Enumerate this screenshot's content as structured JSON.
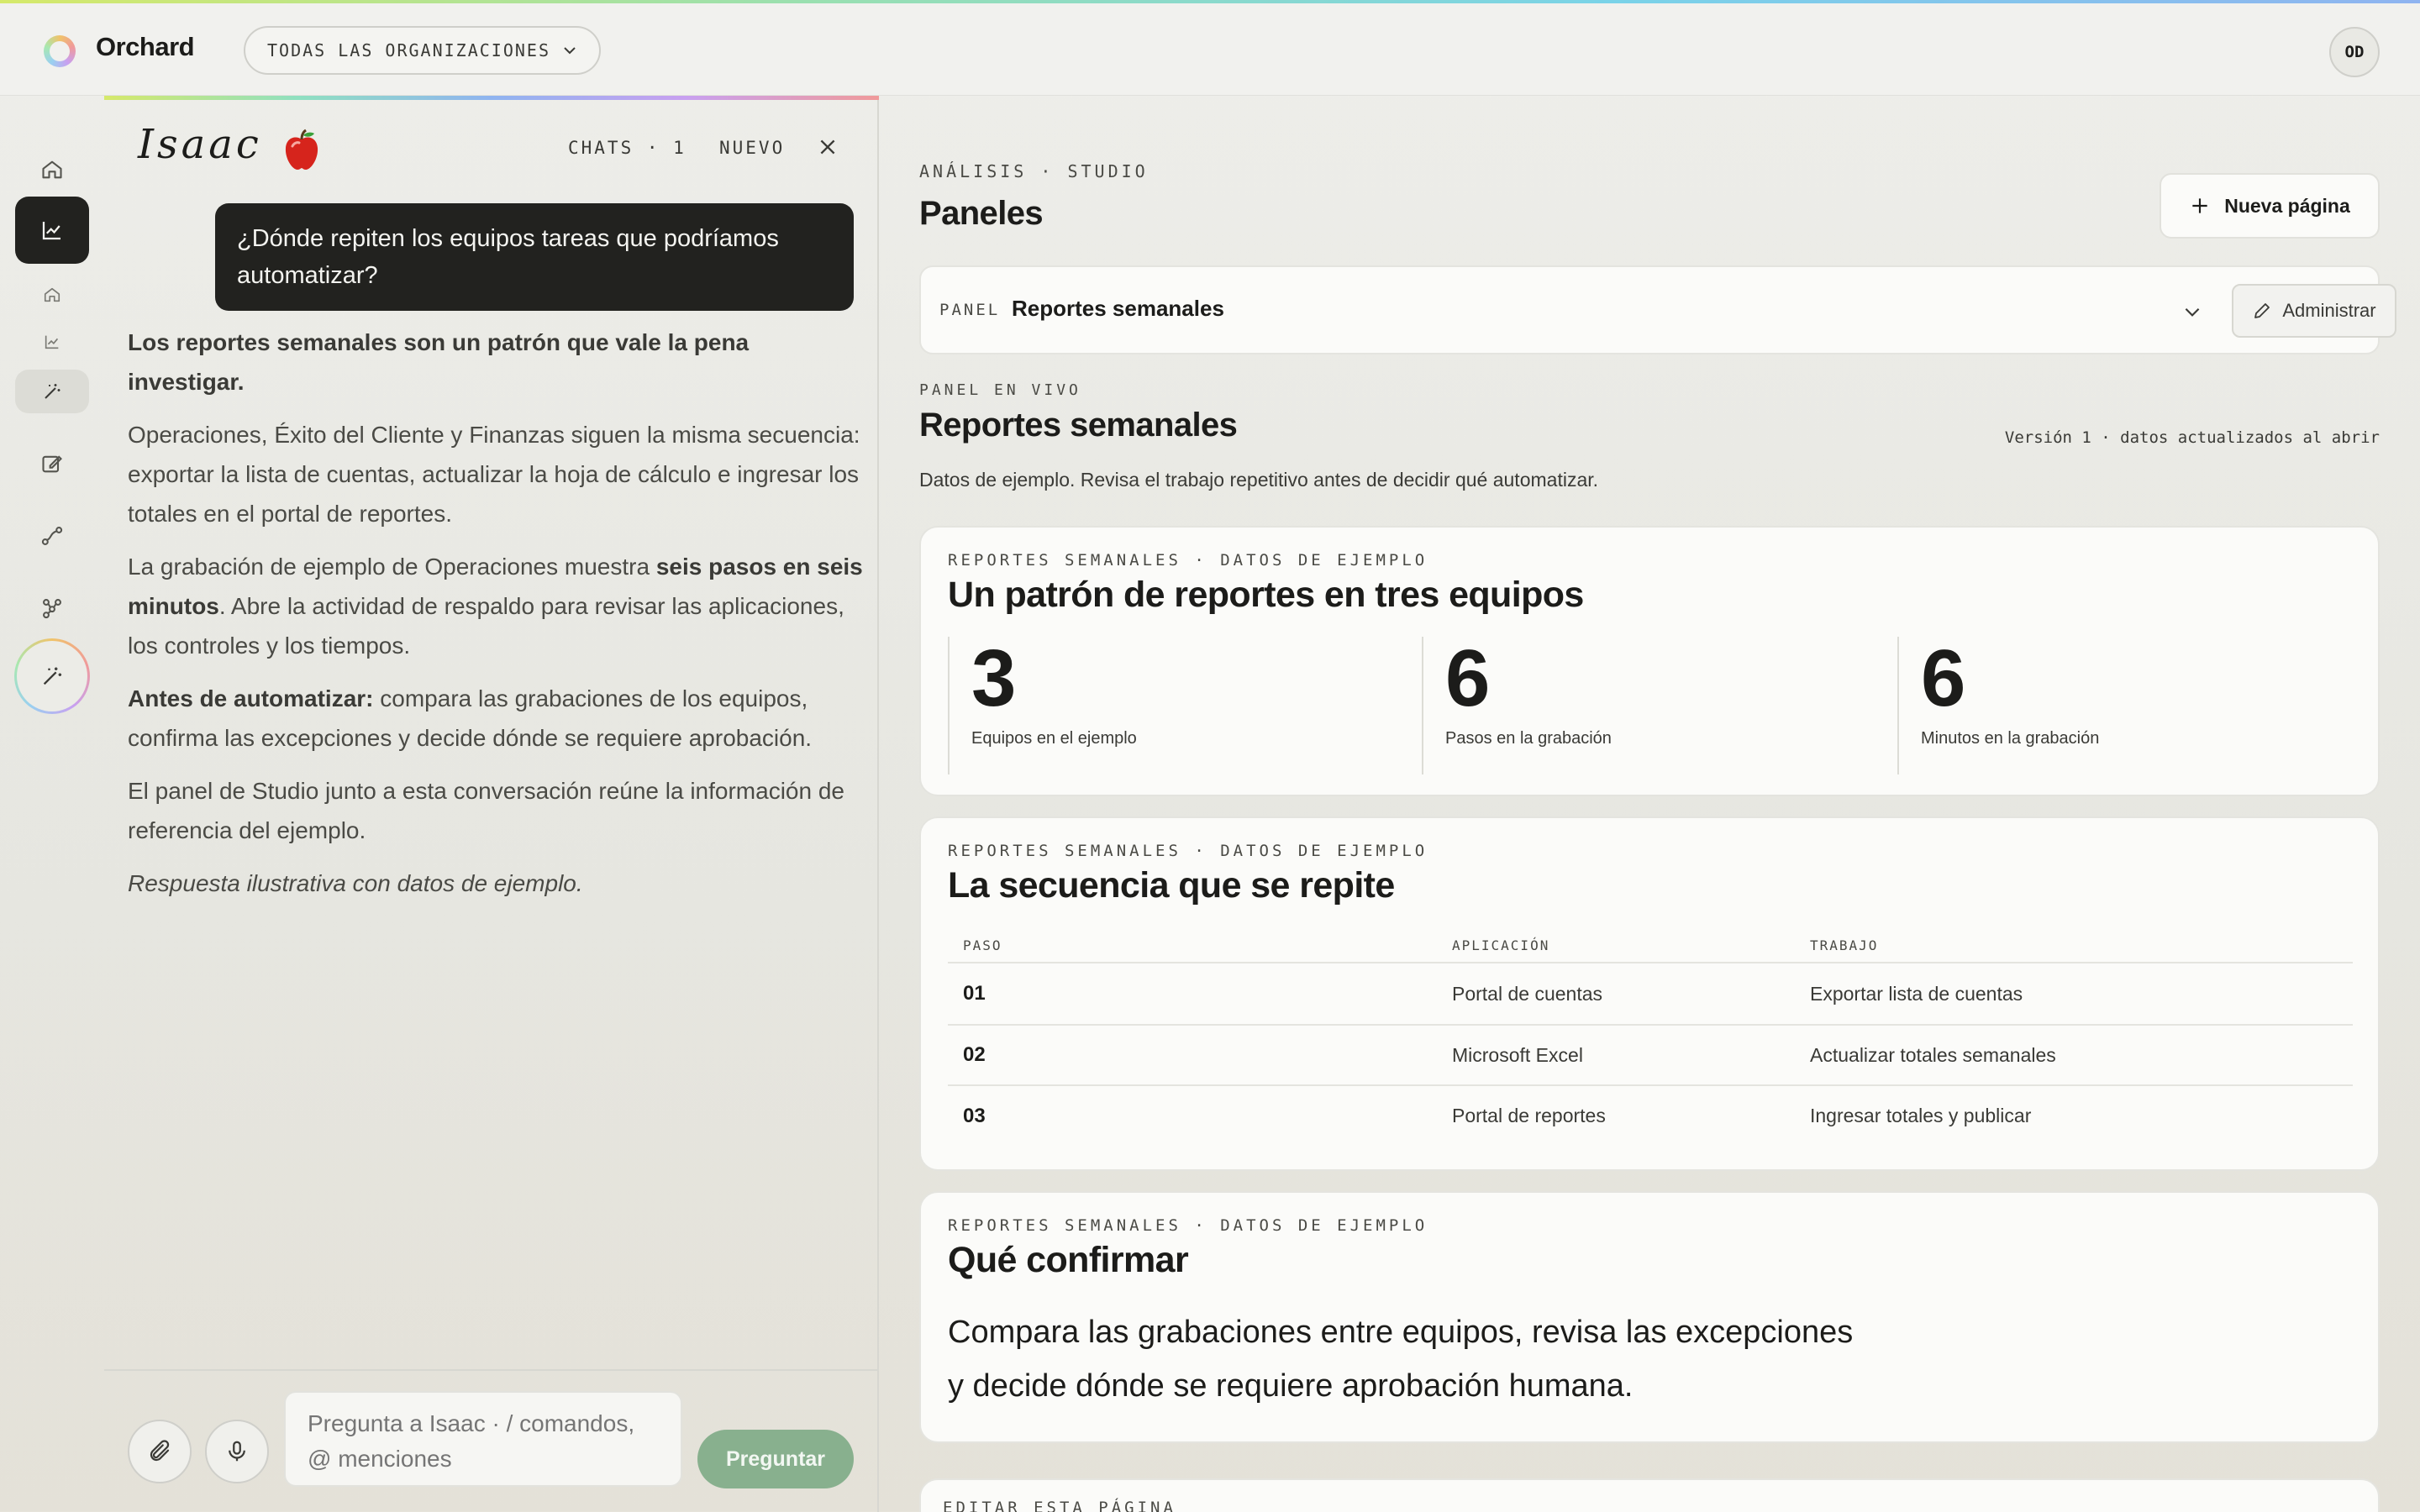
{
  "app": {
    "name": "Orchard",
    "org_selector": "TODAS LAS ORGANIZACIONES",
    "user_initials": "OD"
  },
  "colors": {
    "accent_dark": "#22221f",
    "ask_button": "#88b08e",
    "panel_bg": "#fbfbf9"
  },
  "rail": {
    "icons": [
      "home-icon",
      "chart-icon",
      "home-icon",
      "chart-icon",
      "magic-wand-icon",
      "edit-icon",
      "flow-icon",
      "network-icon",
      "magic-wand-icon"
    ]
  },
  "chat": {
    "assistant_name": "Isaac",
    "chats_label": "CHATS · 1",
    "new_label": "NUEVO",
    "user_message": "¿Dónde repiten los equipos tareas que podríamos automatizar?",
    "answer": {
      "p1": "Los reportes semanales son un patrón que vale la pena investigar.",
      "p2": "Operaciones, Éxito del Cliente y Finanzas siguen la misma secuencia: exportar la lista de cuentas, actualizar la hoja de cálculo e ingresar los totales en el portal de reportes.",
      "p3_a": "La grabación de ejemplo de Operaciones muestra ",
      "p3_b": "seis pasos en seis minutos",
      "p3_c": ". Abre la actividad de respaldo para revisar las aplicaciones, los controles y los tiempos.",
      "p4_a": "Antes de automatizar:",
      "p4_b": " compara las grabaciones de los equipos, confirma las excepciones y decide dónde se requiere aprobación.",
      "p5": "El panel de Studio junto a esta conversación reúne la información de referencia del ejemplo.",
      "p6": "Respuesta ilustrativa con datos de ejemplo."
    },
    "input_placeholder": "Pregunta a Isaac · / comandos, @ menciones",
    "ask_label": "Preguntar"
  },
  "studio": {
    "breadcrumb": "ANÁLISIS · STUDIO",
    "title": "Paneles",
    "new_page": "Nueva página",
    "panel_label": "PANEL",
    "panel_value": "Reportes semanales",
    "manage": "Administrar",
    "live_label": "PANEL EN VIVO",
    "live_title": "Reportes semanales",
    "version": "Versión 1 · datos actualizados al abrir",
    "description": "Datos de ejemplo. Revisa el trabajo repetitivo antes de decidir qué automatizar.",
    "card1": {
      "eyebrow": "REPORTES SEMANALES · DATOS DE EJEMPLO",
      "title": "Un patrón de reportes en tres equipos",
      "stats": [
        {
          "value": "3",
          "label": "Equipos en el ejemplo"
        },
        {
          "value": "6",
          "label": "Pasos en la grabación"
        },
        {
          "value": "6",
          "label": "Minutos en la grabación"
        }
      ]
    },
    "card2": {
      "eyebrow": "REPORTES SEMANALES · DATOS DE EJEMPLO",
      "title": "La secuencia que se repite",
      "columns": [
        "PASO",
        "APLICACIÓN",
        "TRABAJO"
      ],
      "rows": [
        [
          "01",
          "Portal de cuentas",
          "Exportar lista de cuentas"
        ],
        [
          "02",
          "Microsoft Excel",
          "Actualizar totales semanales"
        ],
        [
          "03",
          "Portal de reportes",
          "Ingresar totales y publicar"
        ]
      ]
    },
    "card3": {
      "eyebrow": "REPORTES SEMANALES · DATOS DE EJEMPLO",
      "title": "Qué confirmar",
      "body": "Compara las grabaciones entre equipos, revisa las excepciones y decide dónde se requiere aprobación humana."
    },
    "card4": {
      "eyebrow": "EDITAR ESTA PÁGINA"
    }
  }
}
